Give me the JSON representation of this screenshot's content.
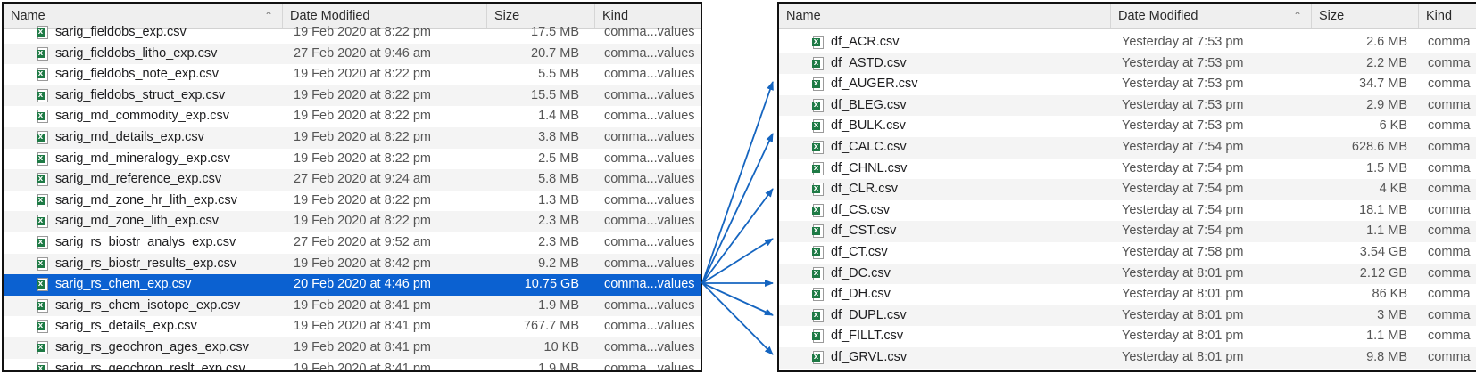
{
  "colors": {
    "selection": "#0b61d1",
    "arrow": "#1565c0",
    "csv_icon": "#1e7a45"
  },
  "left_panel": {
    "headers": {
      "name": "Name",
      "date": "Date Modified",
      "size": "Size",
      "kind": "Kind"
    },
    "sort_icon": "chevron-up-icon",
    "rows": [
      {
        "name": "sarig_fieldobs_exp.csv",
        "date": "19 Feb 2020 at 8:22 pm",
        "size": "17.5 MB",
        "kind": "comma...values"
      },
      {
        "name": "sarig_fieldobs_litho_exp.csv",
        "date": "27 Feb 2020 at 9:46 am",
        "size": "20.7 MB",
        "kind": "comma...values"
      },
      {
        "name": "sarig_fieldobs_note_exp.csv",
        "date": "19 Feb 2020 at 8:22 pm",
        "size": "5.5 MB",
        "kind": "comma...values"
      },
      {
        "name": "sarig_fieldobs_struct_exp.csv",
        "date": "19 Feb 2020 at 8:22 pm",
        "size": "15.5 MB",
        "kind": "comma...values"
      },
      {
        "name": "sarig_md_commodity_exp.csv",
        "date": "19 Feb 2020 at 8:22 pm",
        "size": "1.4 MB",
        "kind": "comma...values"
      },
      {
        "name": "sarig_md_details_exp.csv",
        "date": "19 Feb 2020 at 8:22 pm",
        "size": "3.8 MB",
        "kind": "comma...values"
      },
      {
        "name": "sarig_md_mineralogy_exp.csv",
        "date": "19 Feb 2020 at 8:22 pm",
        "size": "2.5 MB",
        "kind": "comma...values"
      },
      {
        "name": "sarig_md_reference_exp.csv",
        "date": "27 Feb 2020 at 9:24 am",
        "size": "5.8 MB",
        "kind": "comma...values"
      },
      {
        "name": "sarig_md_zone_hr_lith_exp.csv",
        "date": "19 Feb 2020 at 8:22 pm",
        "size": "1.3 MB",
        "kind": "comma...values"
      },
      {
        "name": "sarig_md_zone_lith_exp.csv",
        "date": "19 Feb 2020 at 8:22 pm",
        "size": "2.3 MB",
        "kind": "comma...values"
      },
      {
        "name": "sarig_rs_biostr_analys_exp.csv",
        "date": "27 Feb 2020 at 9:52 am",
        "size": "2.3 MB",
        "kind": "comma...values"
      },
      {
        "name": "sarig_rs_biostr_results_exp.csv",
        "date": "19 Feb 2020 at 8:42 pm",
        "size": "9.2 MB",
        "kind": "comma...values"
      },
      {
        "name": "sarig_rs_chem_exp.csv",
        "date": "20 Feb 2020 at 4:46 pm",
        "size": "10.75 GB",
        "kind": "comma...values",
        "selected": true
      },
      {
        "name": "sarig_rs_chem_isotope_exp.csv",
        "date": "19 Feb 2020 at 8:41 pm",
        "size": "1.9 MB",
        "kind": "comma...values"
      },
      {
        "name": "sarig_rs_details_exp.csv",
        "date": "19 Feb 2020 at 8:41 pm",
        "size": "767.7 MB",
        "kind": "comma...values"
      },
      {
        "name": "sarig_rs_geochron_ages_exp.csv",
        "date": "19 Feb 2020 at 8:41 pm",
        "size": "10 KB",
        "kind": "comma...values"
      },
      {
        "name": "sarig_rs_geochron_reslt_exp.csv",
        "date": "19 Feb 2020 at 8:41 pm",
        "size": "1.9 MB",
        "kind": "comma...values"
      }
    ]
  },
  "right_panel": {
    "headers": {
      "name": "Name",
      "date": "Date Modified",
      "size": "Size",
      "kind": "Kind"
    },
    "sort_icon": "chevron-up-icon",
    "rows": [
      {
        "name": "df_ACR.csv",
        "date": "Yesterday at 7:53 pm",
        "size": "2.6 MB",
        "kind": "comma"
      },
      {
        "name": "df_ASTD.csv",
        "date": "Yesterday at 7:53 pm",
        "size": "2.2 MB",
        "kind": "comma"
      },
      {
        "name": "df_AUGER.csv",
        "date": "Yesterday at 7:53 pm",
        "size": "34.7 MB",
        "kind": "comma"
      },
      {
        "name": "df_BLEG.csv",
        "date": "Yesterday at 7:53 pm",
        "size": "2.9 MB",
        "kind": "comma"
      },
      {
        "name": "df_BULK.csv",
        "date": "Yesterday at 7:53 pm",
        "size": "6 KB",
        "kind": "comma"
      },
      {
        "name": "df_CALC.csv",
        "date": "Yesterday at 7:54 pm",
        "size": "628.6 MB",
        "kind": "comma"
      },
      {
        "name": "df_CHNL.csv",
        "date": "Yesterday at 7:54 pm",
        "size": "1.5 MB",
        "kind": "comma"
      },
      {
        "name": "df_CLR.csv",
        "date": "Yesterday at 7:54 pm",
        "size": "4 KB",
        "kind": "comma"
      },
      {
        "name": "df_CS.csv",
        "date": "Yesterday at 7:54 pm",
        "size": "18.1 MB",
        "kind": "comma"
      },
      {
        "name": "df_CST.csv",
        "date": "Yesterday at 7:54 pm",
        "size": "1.1 MB",
        "kind": "comma"
      },
      {
        "name": "df_CT.csv",
        "date": "Yesterday at 7:58 pm",
        "size": "3.54 GB",
        "kind": "comma"
      },
      {
        "name": "df_DC.csv",
        "date": "Yesterday at 8:01 pm",
        "size": "2.12 GB",
        "kind": "comma"
      },
      {
        "name": "df_DH.csv",
        "date": "Yesterday at 8:01 pm",
        "size": "86 KB",
        "kind": "comma"
      },
      {
        "name": "df_DUPL.csv",
        "date": "Yesterday at 8:01 pm",
        "size": "3 MB",
        "kind": "comma"
      },
      {
        "name": "df_FILLT.csv",
        "date": "Yesterday at 8:01 pm",
        "size": "1.1 MB",
        "kind": "comma"
      },
      {
        "name": "df_GRVL.csv",
        "date": "Yesterday at 8:01 pm",
        "size": "9.8 MB",
        "kind": "comma"
      }
    ]
  }
}
